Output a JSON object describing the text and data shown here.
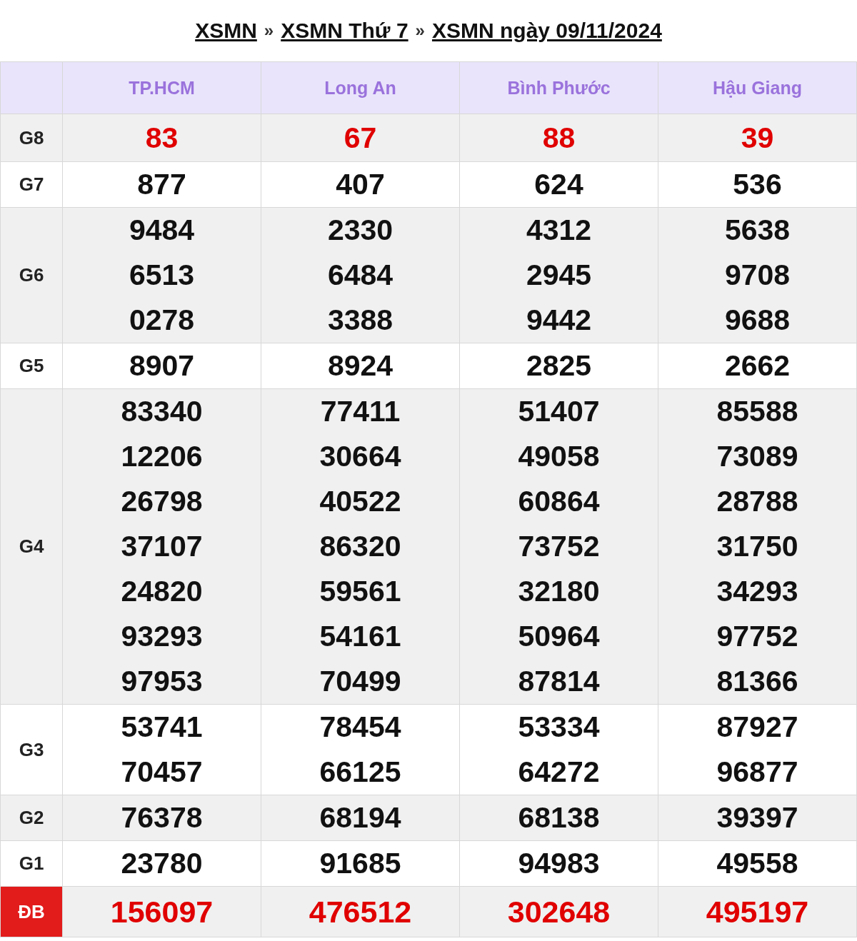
{
  "breadcrumb": {
    "links": [
      "XSMN",
      "XSMN Thứ 7",
      "XSMN ngày 09/11/2024"
    ],
    "separator": "»"
  },
  "provinces": [
    "TP.HCM",
    "Long An",
    "Bình Phước",
    "Hậu Giang"
  ],
  "prizes": [
    {
      "label": "G8",
      "kind": "highlight",
      "results": [
        [
          "83"
        ],
        [
          "67"
        ],
        [
          "88"
        ],
        [
          "39"
        ]
      ]
    },
    {
      "label": "G7",
      "kind": "normal",
      "results": [
        [
          "877"
        ],
        [
          "407"
        ],
        [
          "624"
        ],
        [
          "536"
        ]
      ]
    },
    {
      "label": "G6",
      "kind": "normal",
      "results": [
        [
          "9484",
          "6513",
          "0278"
        ],
        [
          "2330",
          "6484",
          "3388"
        ],
        [
          "4312",
          "2945",
          "9442"
        ],
        [
          "5638",
          "9708",
          "9688"
        ]
      ]
    },
    {
      "label": "G5",
      "kind": "normal",
      "results": [
        [
          "8907"
        ],
        [
          "8924"
        ],
        [
          "2825"
        ],
        [
          "2662"
        ]
      ]
    },
    {
      "label": "G4",
      "kind": "normal",
      "results": [
        [
          "83340",
          "12206",
          "26798",
          "37107",
          "24820",
          "93293",
          "97953"
        ],
        [
          "77411",
          "30664",
          "40522",
          "86320",
          "59561",
          "54161",
          "70499"
        ],
        [
          "51407",
          "49058",
          "60864",
          "73752",
          "32180",
          "50964",
          "87814"
        ],
        [
          "85588",
          "73089",
          "28788",
          "31750",
          "34293",
          "97752",
          "81366"
        ]
      ]
    },
    {
      "label": "G3",
      "kind": "normal",
      "results": [
        [
          "53741",
          "70457"
        ],
        [
          "78454",
          "66125"
        ],
        [
          "53334",
          "64272"
        ],
        [
          "87927",
          "96877"
        ]
      ]
    },
    {
      "label": "G2",
      "kind": "normal",
      "results": [
        [
          "76378"
        ],
        [
          "68194"
        ],
        [
          "68138"
        ],
        [
          "39397"
        ]
      ]
    },
    {
      "label": "G1",
      "kind": "normal",
      "results": [
        [
          "23780"
        ],
        [
          "91685"
        ],
        [
          "94983"
        ],
        [
          "49558"
        ]
      ]
    },
    {
      "label": "ĐB",
      "kind": "special",
      "results": [
        [
          "156097"
        ],
        [
          "476512"
        ],
        [
          "302648"
        ],
        [
          "495197"
        ]
      ]
    }
  ]
}
